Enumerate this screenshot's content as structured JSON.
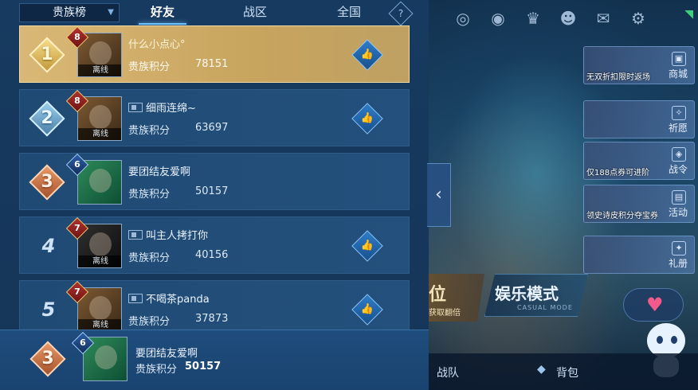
{
  "tabs": {
    "dropdown_label": "贵族榜",
    "items": [
      "好友",
      "战区",
      "全国"
    ],
    "active": "好友",
    "help_icon": "?"
  },
  "rows": [
    {
      "rank": "1",
      "level": "8",
      "name": "什么小点心°",
      "score_label": "贵族积分",
      "score": "78151",
      "offline": "离线",
      "has_like": true,
      "has_pm": false
    },
    {
      "rank": "2",
      "level": "8",
      "name": "细雨连绵~",
      "score_label": "贵族积分",
      "score": "63697",
      "offline": "离线",
      "has_like": true,
      "has_pm": true
    },
    {
      "rank": "3",
      "level": "6",
      "name": "要团结友爱啊",
      "score_label": "贵族积分",
      "score": "50157",
      "offline": "",
      "has_like": false,
      "has_pm": false
    },
    {
      "rank": "4",
      "level": "7",
      "name": "叫主人拷打你",
      "score_label": "贵族积分",
      "score": "40156",
      "offline": "离线",
      "has_like": true,
      "has_pm": true
    },
    {
      "rank": "5",
      "level": "7",
      "name": "不喝茶panda",
      "score_label": "贵族积分",
      "score": "37873",
      "offline": "离线",
      "has_like": true,
      "has_pm": true
    }
  ],
  "me": {
    "rank": "3",
    "level": "6",
    "name": "要团结友爱啊",
    "score_label": "贵族积分",
    "score": "50157"
  },
  "right": {
    "side_cards": [
      {
        "label": "无双折扣限时返场",
        "button": "商城"
      },
      {
        "label": "",
        "button": "祈愿"
      },
      {
        "label": "仅188点券可进阶",
        "button": "战令"
      },
      {
        "label": "领史诗皮积分夺宝券",
        "button": "活动"
      },
      {
        "label": "",
        "button": "礼册"
      }
    ],
    "mode_rank_title": "位",
    "mode_rank_sub": "获取翻倍",
    "mode_entertain_title": "娱乐模式",
    "mode_entertain_sub": "CASUAL MODE",
    "bottom_team": "战队",
    "bottom_bag": "背包"
  },
  "colors": {
    "gold_row": "#d9b776",
    "row_bg": "#1f4a74",
    "accent": "#6fc3ff"
  }
}
